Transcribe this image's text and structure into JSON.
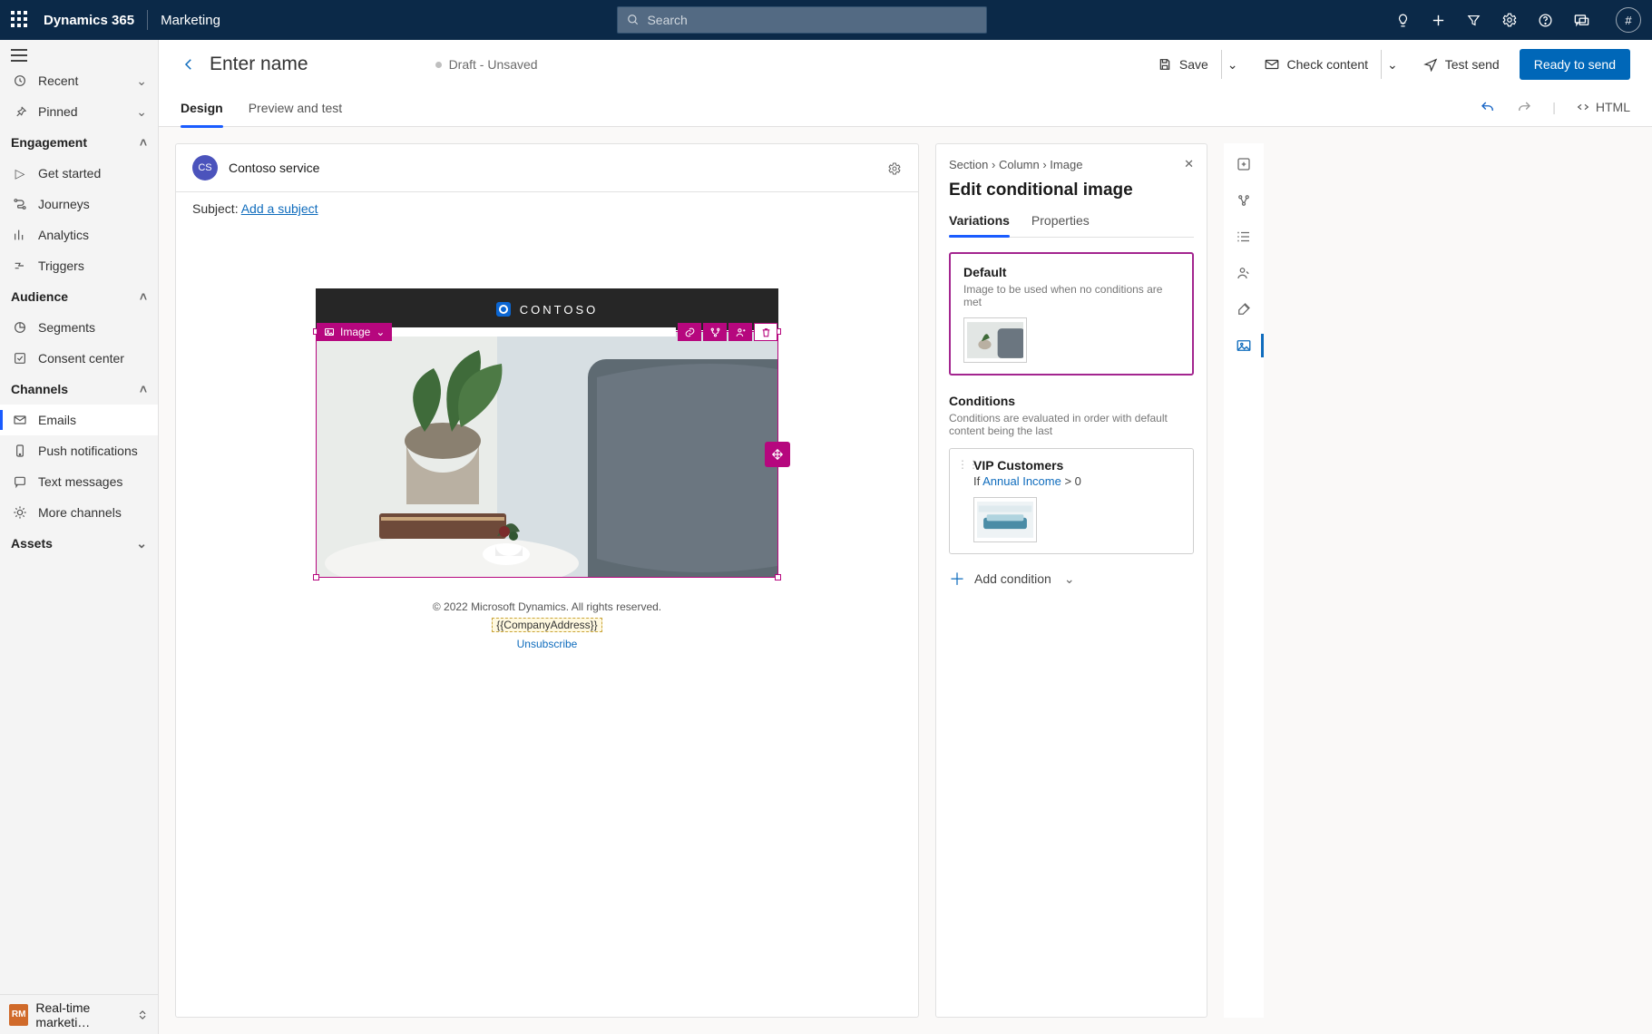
{
  "nav": {
    "brand": "Dynamics 365",
    "module": "Marketing",
    "search_placeholder": "Search",
    "avatar": "#"
  },
  "leftnav": {
    "recent": "Recent",
    "pinned": "Pinned",
    "groups": {
      "engagement": "Engagement",
      "audience": "Audience",
      "channels": "Channels",
      "assets": "Assets"
    },
    "items": {
      "get_started": "Get started",
      "journeys": "Journeys",
      "analytics": "Analytics",
      "triggers": "Triggers",
      "segments": "Segments",
      "consent": "Consent center",
      "emails": "Emails",
      "push": "Push notifications",
      "text": "Text messages",
      "more": "More channels"
    },
    "bottom": "Real-time marketi…",
    "bottom_badge": "RM"
  },
  "header": {
    "title": "Enter name",
    "status": "Draft - Unsaved",
    "save": "Save",
    "check": "Check content",
    "test": "Test send",
    "ready": "Ready to send"
  },
  "tabs": {
    "design": "Design",
    "preview": "Preview and test",
    "html": "HTML"
  },
  "card": {
    "badge": "CS",
    "service": "Contoso service",
    "subject_label": "Subject:",
    "subject_link": "Add a subject"
  },
  "email": {
    "brand": "CONTOSO",
    "img_tag": "Image",
    "footer_copy": "© 2022 Microsoft Dynamics. All rights reserved.",
    "token": "{{CompanyAddress}}",
    "unsub": "Unsubscribe"
  },
  "panel": {
    "crumb1": "Section",
    "crumb2": "Column",
    "crumb3": "Image",
    "title": "Edit conditional image",
    "tab_variations": "Variations",
    "tab_properties": "Properties",
    "default": {
      "title": "Default",
      "desc": "Image to be used when no conditions are met"
    },
    "cond_head": "Conditions",
    "cond_sub": "Conditions are evaluated in order with default content being the last",
    "vip": {
      "title": "VIP Customers",
      "if": "If ",
      "field": "Annual Income",
      "rest": " > 0"
    },
    "add": "Add condition"
  }
}
